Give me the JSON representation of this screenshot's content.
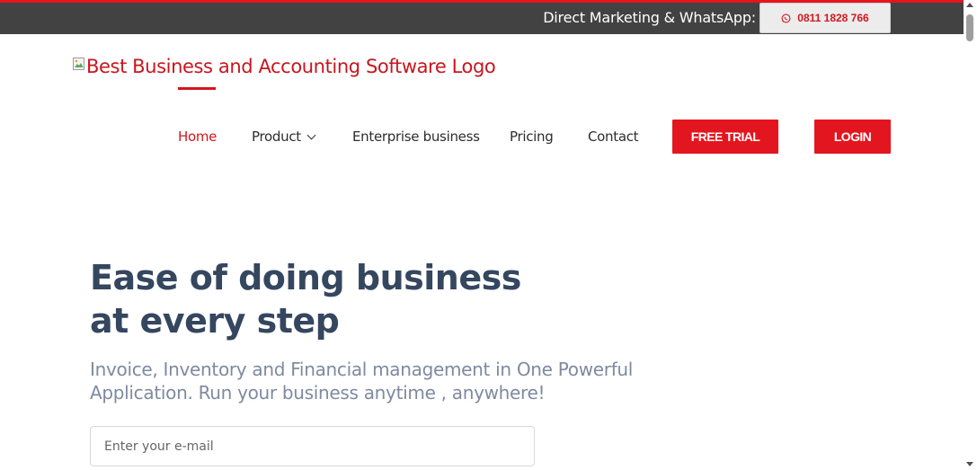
{
  "topbar": {
    "label": "Direct Marketing & WhatsApp:",
    "whatsapp_number": "0811 1828 766",
    "whatsapp_icon": "whatsapp-icon"
  },
  "logo": {
    "alt_text": "Best Business and Accounting Software Logo",
    "broken_image_icon": "broken-image-icon"
  },
  "nav": {
    "items": [
      {
        "label": "Home",
        "active": true
      },
      {
        "label": "Product",
        "has_dropdown": true
      },
      {
        "label": "Enterprise business"
      },
      {
        "label": "Pricing"
      },
      {
        "label": "Contact"
      }
    ],
    "free_trial_label": "FREE TRIAL",
    "login_label": "LOGIN"
  },
  "hero": {
    "title_line1": "Ease of doing business",
    "title_line2": "at every step",
    "subtitle_line1": "Invoice, Inventory and Financial management in One Powerful",
    "subtitle_line2": "Application. Run your business anytime , anywhere!",
    "email_placeholder": "Enter your e-mail"
  },
  "colors": {
    "brand_red": "#e3161f",
    "topbar_bg": "#424242",
    "hero_title": "#35465f",
    "hero_subtitle": "#7f8aa0"
  }
}
